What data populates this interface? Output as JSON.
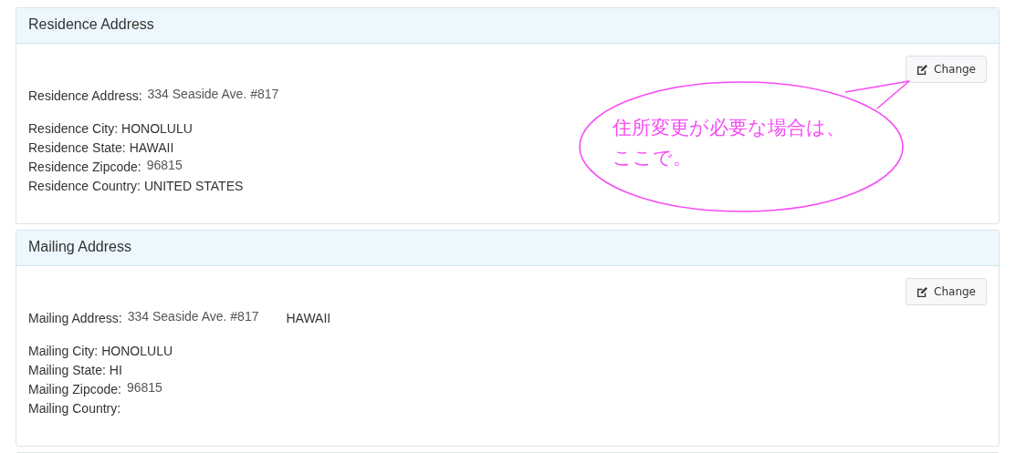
{
  "sections": [
    {
      "title": "Residence Address",
      "change_button": "Change",
      "address": {
        "label": "Residence Address:",
        "value": "334 Seaside Ave. #817"
      },
      "fields": [
        {
          "label": "Residence City:",
          "value": "HONOLULU",
          "kind": "plain"
        },
        {
          "label": "Residence State:",
          "value": "HAWAII",
          "kind": "plain"
        },
        {
          "label": "Residence Zipcode:",
          "value": "96815",
          "kind": "typed"
        },
        {
          "label": "Residence Country:",
          "value": "UNITED STATES",
          "kind": "plain"
        }
      ],
      "callout": {
        "lines": [
          "住所変更が必要な場合は、",
          "ここで。"
        ]
      }
    },
    {
      "title": "Mailing Address",
      "change_button": "Change",
      "address": {
        "label": "Mailing Address:",
        "value": "334 Seaside Ave. #817",
        "extra": "HAWAII"
      },
      "fields": [
        {
          "label": "Mailing City:",
          "value": "HONOLULU",
          "kind": "plain"
        },
        {
          "label": "Mailing State:",
          "value": "HI",
          "kind": "plain"
        },
        {
          "label": "Mailing Zipcode:",
          "value": "96815",
          "kind": "typed"
        },
        {
          "label": "Mailing Country:",
          "kind": "plain"
        }
      ]
    }
  ]
}
